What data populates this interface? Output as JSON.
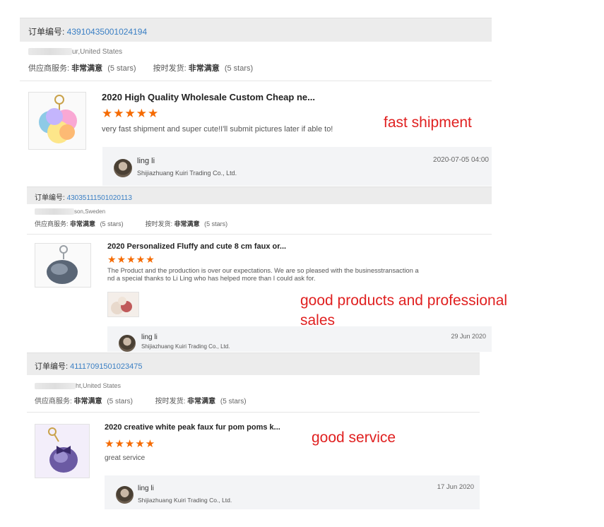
{
  "orders": [
    {
      "order_label": "订单编号: ",
      "order_number": "43910435001024194",
      "location": "ur,United States",
      "service_label": "供应商服务:",
      "service_value": "非常满意",
      "service_stars": "(5 stars)",
      "shipping_label": "按时发货:",
      "shipping_value": "非常满意",
      "shipping_stars": "(5 stars)",
      "product_title": "2020 High Quality Wholesale Custom Cheap ne...",
      "stars": "★★★★★",
      "review_text": "very fast shipment and super cute!I'll submit pictures later if able to!",
      "reply_name": "ling li",
      "reply_company": "Shijiazhuang Kuiri Trading Co., Ltd.",
      "reply_date": "2020-07-05 04:00",
      "annotation": "fast shipment"
    },
    {
      "order_label": "订单编号: ",
      "order_number": "43035111501020113",
      "location": "son,Sweden",
      "service_label": "供应商服务:",
      "service_value": "非常满意",
      "service_stars": "(5 stars)",
      "shipping_label": "按时发货:",
      "shipping_value": "非常满意",
      "shipping_stars": "(5 stars)",
      "product_title": "2020 Personalized Fluffy and cute 8 cm faux or...",
      "stars": "★★★★★",
      "review_text_line1": "The Product and the production is over our expectations. We are so pleased with the businesstransaction a",
      "review_text_line2": "nd a special thanks to Li Ling who has helped more than I could ask for.",
      "reply_name": "ling li",
      "reply_company": "Shijiazhuang Kuiri Trading Co., Ltd.",
      "reply_date": "29 Jun 2020",
      "annotation_line1": "good products and professional",
      "annotation_line2": "sales"
    },
    {
      "order_label": "订单编号: ",
      "order_number": "41117091501023475",
      "location": "ht,United States",
      "service_label": "供应商服务:",
      "service_value": "非常满意",
      "service_stars": "(5 stars)",
      "shipping_label": "按时发货:",
      "shipping_value": "非常满意",
      "shipping_stars": "(5 stars)",
      "product_title": "2020 creative white peak faux fur pom poms k...",
      "stars": "★★★★★",
      "review_text": "great service",
      "reply_name": "ling li",
      "reply_company": "Shijiazhuang Kuiri Trading Co., Ltd.",
      "reply_date": "17 Jun 2020",
      "annotation": "good service"
    }
  ],
  "colors": {
    "order_number": "#3a7fc4",
    "star": "#f56a00",
    "annotation": "#e02020",
    "order_bar": "#ececec",
    "reply_bg": "#f3f4f6"
  }
}
